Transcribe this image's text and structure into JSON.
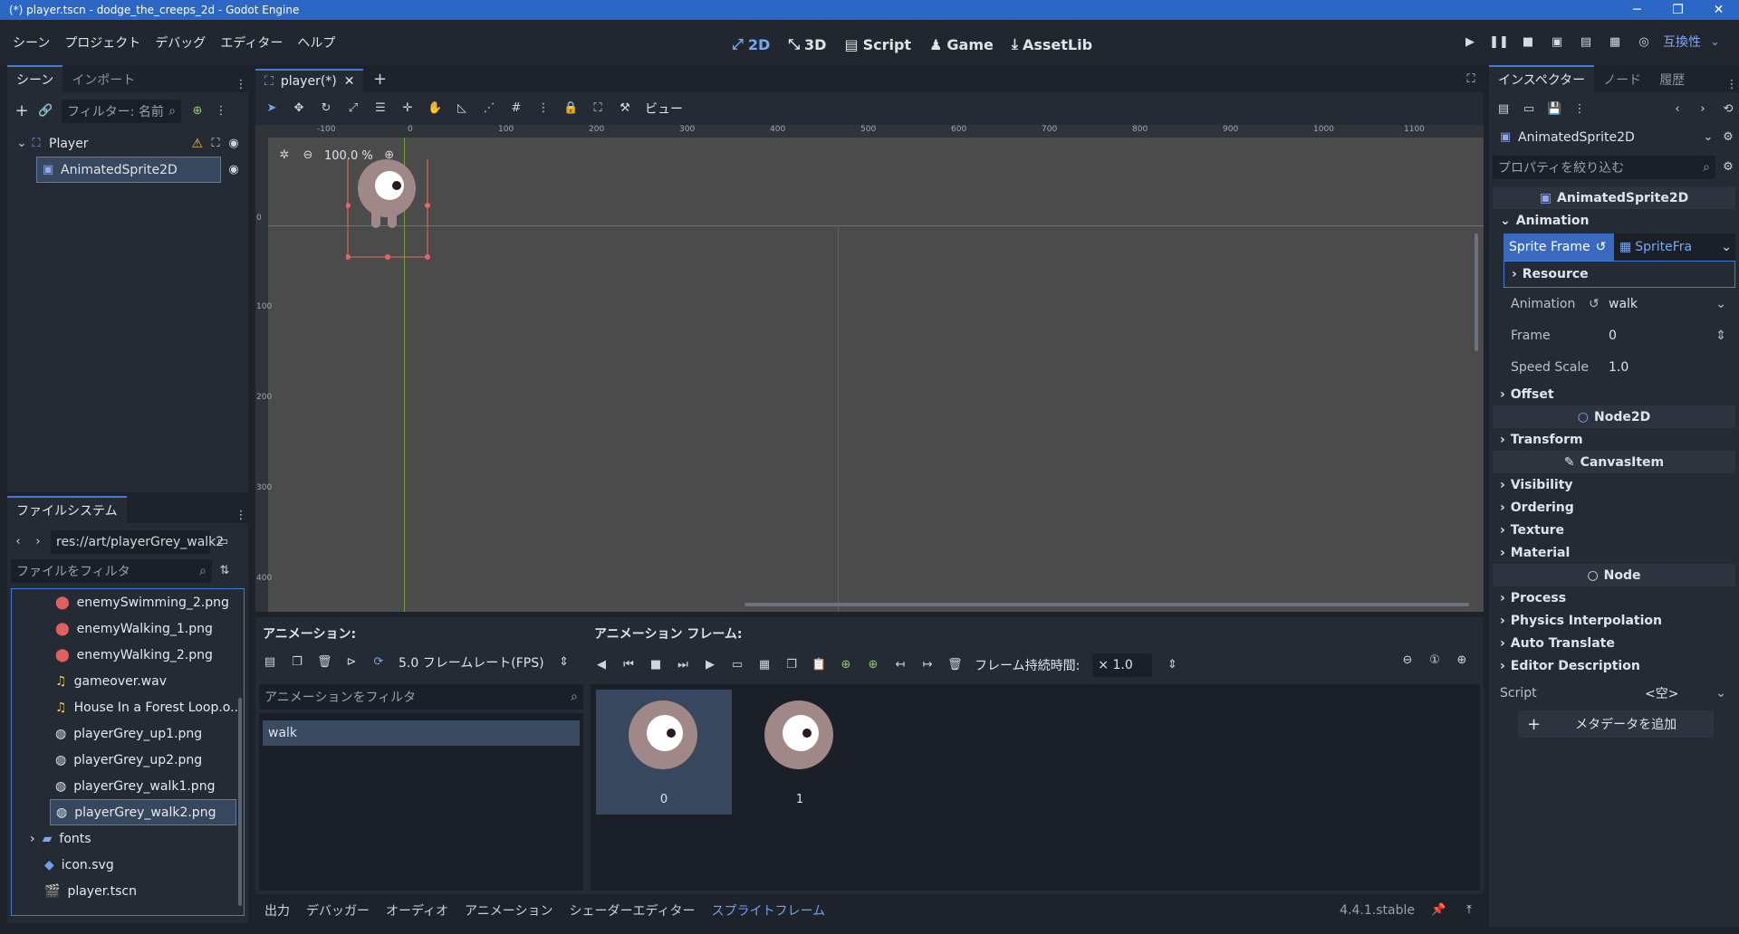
{
  "window": {
    "title": "(*) player.tscn - dodge_the_creeps_2d - Godot Engine",
    "min": "─",
    "max": "❐",
    "close": "✕"
  },
  "menu": [
    "シーン",
    "プロジェクト",
    "デバッグ",
    "エディター",
    "ヘルプ"
  ],
  "main_tabs": [
    {
      "label": "2D",
      "icon": "⤢"
    },
    {
      "label": "3D",
      "icon": "⤡"
    },
    {
      "label": "Script",
      "icon": "▤"
    },
    {
      "label": "Game",
      "icon": "♟"
    },
    {
      "label": "AssetLib",
      "icon": "⤓"
    }
  ],
  "compat_label": "互換性",
  "scene_panel": {
    "tabs": [
      "シーン",
      "インポート"
    ],
    "filter_placeholder": "フィルター: 名前",
    "nodes": [
      "Player",
      "AnimatedSprite2D"
    ]
  },
  "filesystem": {
    "tab": "ファイルシステム",
    "path": "res://art/playerGrey_walk2",
    "filter_placeholder": "ファイルをフィルタ",
    "items": [
      "enemySwimming_2.png",
      "enemyWalking_1.png",
      "enemyWalking_2.png",
      "gameover.wav",
      "House In a Forest Loop.o...",
      "playerGrey_up1.png",
      "playerGrey_up2.png",
      "playerGrey_walk1.png",
      "playerGrey_walk2.png",
      "fonts",
      "icon.svg",
      "player.tscn"
    ]
  },
  "editor_tab": "player(*)",
  "view_label": "ビュー",
  "zoom": "100.0 %",
  "ruler_x": [
    "-100",
    "0",
    "100",
    "200",
    "300",
    "400",
    "500",
    "600",
    "700",
    "800",
    "900",
    "1000",
    "1100"
  ],
  "ruler_y": [
    "0",
    "100",
    "200",
    "300",
    "400"
  ],
  "anim_panel": {
    "anim_label": "アニメーション:",
    "frames_label": "アニメーション フレーム:",
    "fps": "5.0 フレームレート(FPS)",
    "duration_label": "フレーム持続時間:",
    "duration_value": "× 1.0",
    "filter_placeholder": "アニメーションをフィルタ",
    "animations": [
      "walk"
    ],
    "frames": [
      "0",
      "1"
    ]
  },
  "bottom_tabs": [
    "出力",
    "デバッガー",
    "オーディオ",
    "アニメーション",
    "シェーダーエディター",
    "スプライトフレーム"
  ],
  "version": "4.4.1.stable",
  "inspector": {
    "tabs": [
      "インスペクター",
      "ノード",
      "履歴"
    ],
    "node": "AnimatedSprite2D",
    "filter_placeholder": "プロパティを絞り込む",
    "class_header": "AnimatedSprite2D",
    "animation_section": "Animation",
    "sprite_frame_label": "Sprite Frame",
    "sprite_frame_value": "SpriteFra",
    "resource": "Resource",
    "props": [
      {
        "label": "Animation",
        "value": "walk"
      },
      {
        "label": "Frame",
        "value": "0"
      },
      {
        "label": "Speed Scale",
        "value": "1.0"
      }
    ],
    "offset": "Offset",
    "node2d": "Node2D",
    "transform": "Transform",
    "canvas_item": "CanvasItem",
    "canvas_sections": [
      "Visibility",
      "Ordering",
      "Texture",
      "Material"
    ],
    "node_header": "Node",
    "node_sections": [
      "Process",
      "Physics Interpolation",
      "Auto Translate",
      "Editor Description"
    ],
    "script_label": "Script",
    "script_value": "<空>",
    "add_meta": "メタデータを追加"
  }
}
